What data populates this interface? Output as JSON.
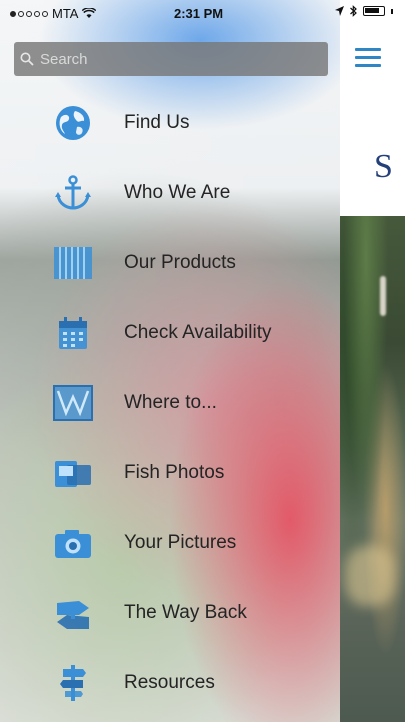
{
  "status_bar": {
    "carrier": "MTA",
    "time": "2:31 PM"
  },
  "search": {
    "placeholder": "Search"
  },
  "menu": {
    "items": [
      {
        "label": "Find Us",
        "icon": "globe-icon"
      },
      {
        "label": "Who We Are",
        "icon": "anchor-icon"
      },
      {
        "label": "Our Products",
        "icon": "products-icon"
      },
      {
        "label": "Check Availability",
        "icon": "calendar-icon"
      },
      {
        "label": "Where to...",
        "icon": "map-icon"
      },
      {
        "label": "Fish Photos",
        "icon": "photos-icon"
      },
      {
        "label": "Your Pictures",
        "icon": "camera-icon"
      },
      {
        "label": "The Way Back",
        "icon": "directions-icon"
      },
      {
        "label": "Resources",
        "icon": "signpost-icon"
      }
    ]
  },
  "background": {
    "title_fragment": "S"
  },
  "colors": {
    "icon_blue": "#2f86c5",
    "title_navy": "#24407a"
  }
}
